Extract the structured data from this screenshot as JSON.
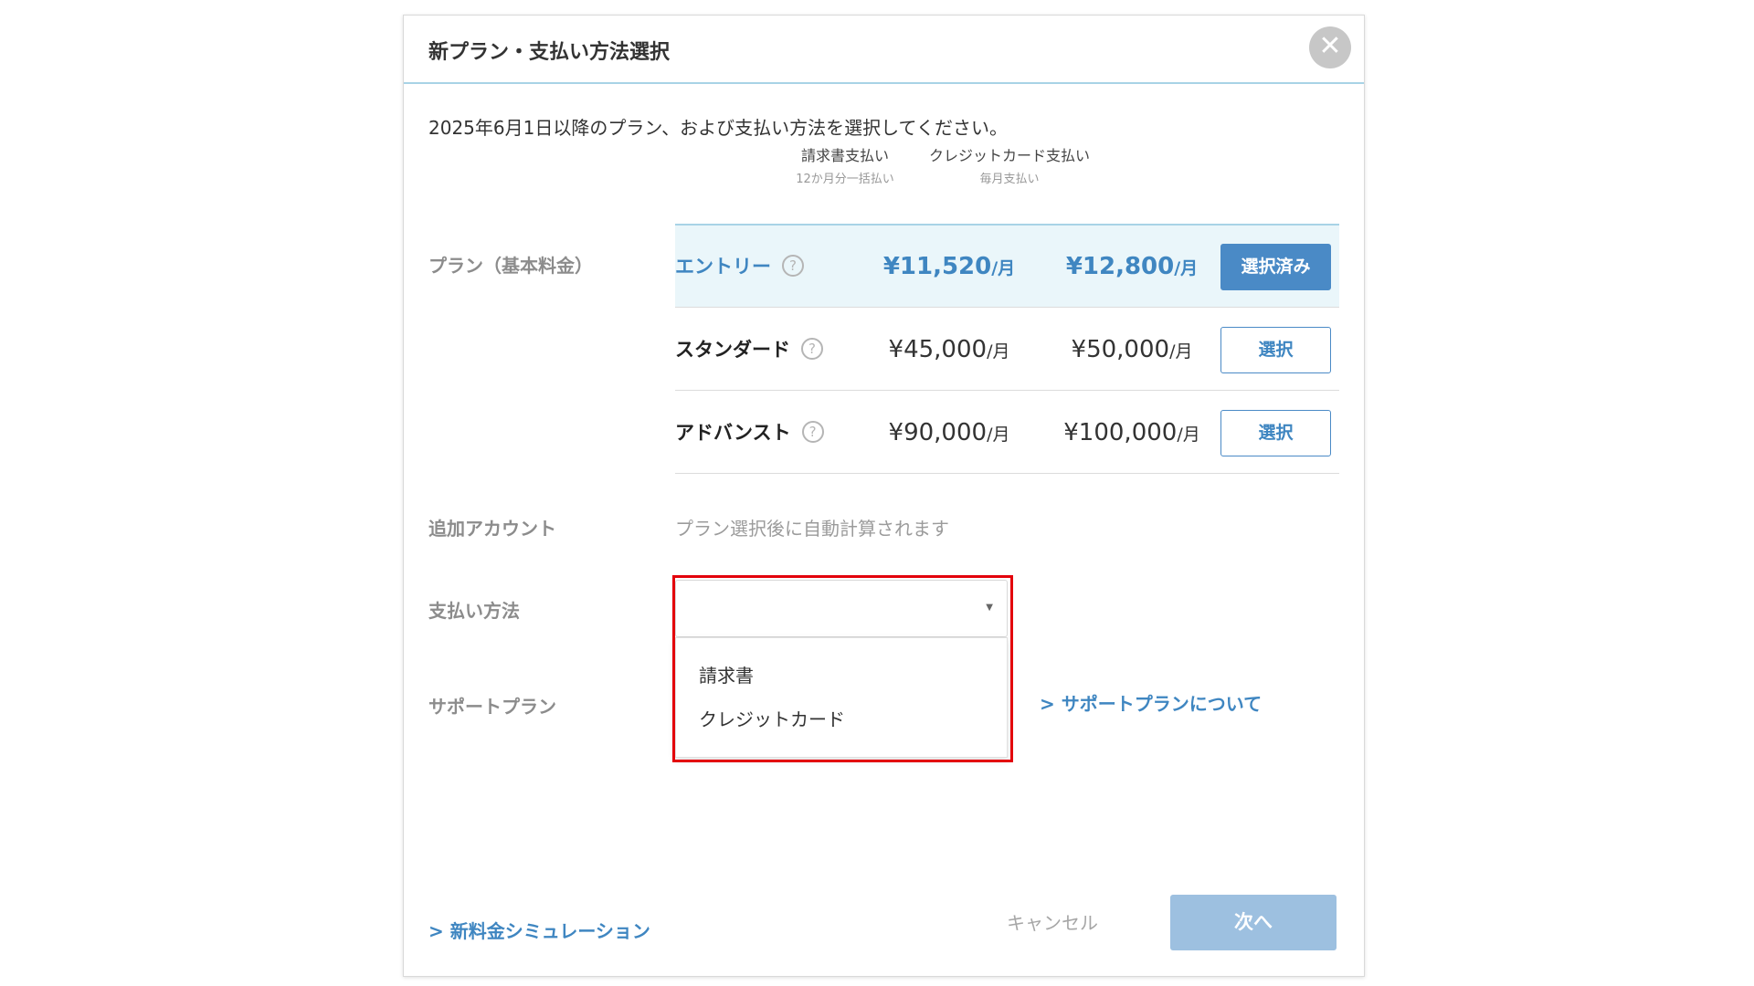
{
  "dialog": {
    "title": "新プラン・支払い方法選択",
    "close_symbol": "✕",
    "intro": "2025年6月1日以降のプラン、および支払い方法を選択してください。"
  },
  "columns": {
    "invoice": {
      "title": "請求書支払い",
      "subtitle": "12か月分一括払い"
    },
    "card": {
      "title": "クレジットカード支払い",
      "subtitle": "毎月支払い"
    }
  },
  "labels": {
    "plan": "プラン（基本料金）",
    "additional_account": "追加アカウント",
    "payment_method": "支払い方法",
    "support_plan": "サポートプラン"
  },
  "plans": [
    {
      "name": "エントリー",
      "invoice_price": "¥11,520",
      "card_price": "¥12,800",
      "unit": "/月",
      "button": "選択済み",
      "selected": true
    },
    {
      "name": "スタンダード",
      "invoice_price": "¥45,000",
      "card_price": "¥50,000",
      "unit": "/月",
      "button": "選択",
      "selected": false
    },
    {
      "name": "アドバンスト",
      "invoice_price": "¥90,000",
      "card_price": "¥100,000",
      "unit": "/月",
      "button": "選択",
      "selected": false
    }
  ],
  "help_symbol": "?",
  "additional_account_note": "プラン選択後に自動計算されます",
  "payment_select": {
    "value": "",
    "caret": "▼",
    "options": [
      "請求書",
      "クレジットカード"
    ]
  },
  "links": {
    "support_plan": "> サポートプランについて",
    "simulation": "> 新料金シミュレーション"
  },
  "footer": {
    "cancel": "キャンセル",
    "next": "次へ"
  },
  "colors": {
    "accent": "#4a8ac6",
    "selected_row_bg": "#eaf6fa",
    "highlight": "#e3000b",
    "next_disabled": "#9dc0e0"
  }
}
